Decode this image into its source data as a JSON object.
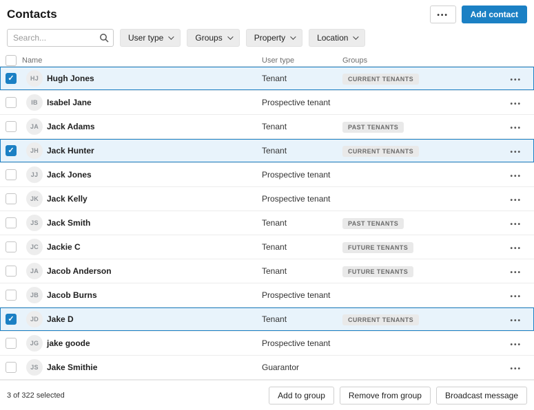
{
  "header": {
    "title": "Contacts",
    "more_label": "•••",
    "add_contact_label": "Add contact"
  },
  "filters": {
    "search_placeholder": "Search...",
    "buttons": [
      {
        "label": "User type",
        "name": "filter-user-type"
      },
      {
        "label": "Groups",
        "name": "filter-groups"
      },
      {
        "label": "Property",
        "name": "filter-property"
      },
      {
        "label": "Location",
        "name": "filter-location"
      }
    ]
  },
  "table": {
    "columns": [
      "Name",
      "User type",
      "Groups"
    ],
    "rows": [
      {
        "initials": "HJ",
        "name": "Hugh Jones",
        "user_type": "Tenant",
        "group": "CURRENT TENANTS",
        "selected": true
      },
      {
        "initials": "IB",
        "name": "Isabel Jane",
        "user_type": "Prospective tenant",
        "group": "",
        "selected": false
      },
      {
        "initials": "JA",
        "name": "Jack Adams",
        "user_type": "Tenant",
        "group": "PAST TENANTS",
        "selected": false
      },
      {
        "initials": "JH",
        "name": "Jack Hunter",
        "user_type": "Tenant",
        "group": "CURRENT TENANTS",
        "selected": true
      },
      {
        "initials": "JJ",
        "name": "Jack Jones",
        "user_type": "Prospective tenant",
        "group": "",
        "selected": false
      },
      {
        "initials": "JK",
        "name": "Jack Kelly",
        "user_type": "Prospective tenant",
        "group": "",
        "selected": false
      },
      {
        "initials": "JS",
        "name": "Jack Smith",
        "user_type": "Tenant",
        "group": "PAST TENANTS",
        "selected": false
      },
      {
        "initials": "JC",
        "name": "Jackie C",
        "user_type": "Tenant",
        "group": "FUTURE TENANTS",
        "selected": false
      },
      {
        "initials": "JA",
        "name": "Jacob Anderson",
        "user_type": "Tenant",
        "group": "FUTURE TENANTS",
        "selected": false
      },
      {
        "initials": "JB",
        "name": "Jacob Burns",
        "user_type": "Prospective tenant",
        "group": "",
        "selected": false
      },
      {
        "initials": "JD",
        "name": "Jake D",
        "user_type": "Tenant",
        "group": "CURRENT TENANTS",
        "selected": true
      },
      {
        "initials": "JG",
        "name": "jake goode",
        "user_type": "Prospective tenant",
        "group": "",
        "selected": false
      },
      {
        "initials": "JS",
        "name": "Jake Smithie",
        "user_type": "Guarantor",
        "group": "",
        "selected": false
      }
    ]
  },
  "footer": {
    "selection_text": "3 of 322 selected",
    "buttons": [
      {
        "label": "Add to group",
        "name": "add-to-group-button"
      },
      {
        "label": "Remove from group",
        "name": "remove-from-group-button"
      },
      {
        "label": "Broadcast message",
        "name": "broadcast-message-button"
      }
    ]
  },
  "colors": {
    "accent_blue": "#1b80c4",
    "selected_row_bg": "#e8f3fb",
    "badge_bg": "#e9e9e9"
  }
}
